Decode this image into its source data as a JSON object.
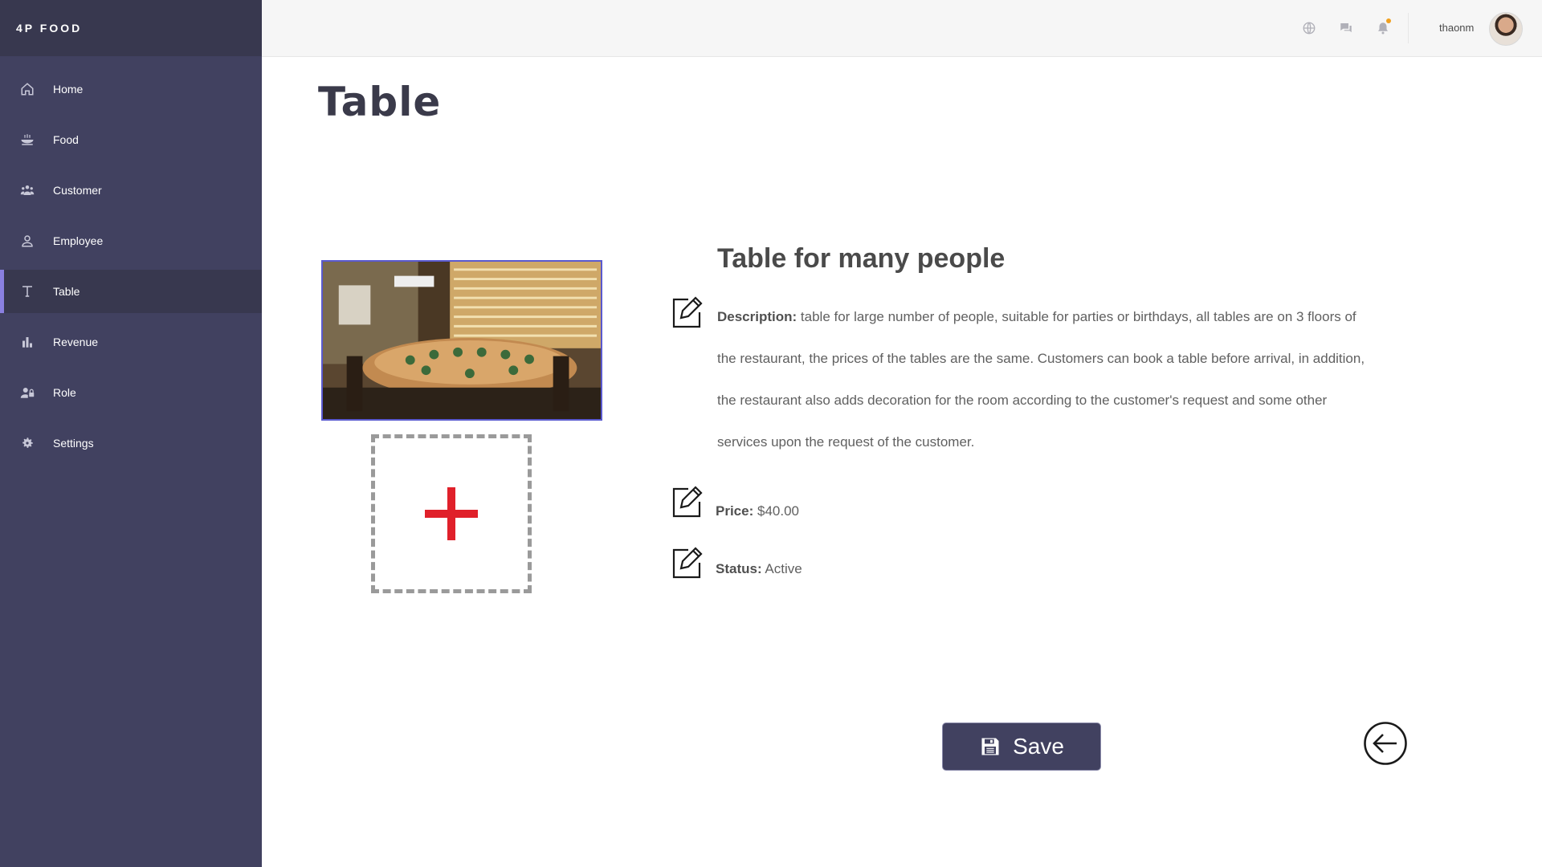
{
  "brand": "4P FOOD",
  "sidebar": {
    "items": [
      {
        "label": "Home",
        "icon": "home-icon"
      },
      {
        "label": "Food",
        "icon": "food-bowl-icon"
      },
      {
        "label": "Customer",
        "icon": "users-icon"
      },
      {
        "label": "Employee",
        "icon": "person-icon"
      },
      {
        "label": "Table",
        "icon": "text-t-icon",
        "active": true
      },
      {
        "label": "Revenue",
        "icon": "bar-chart-icon"
      },
      {
        "label": "Role",
        "icon": "user-lock-icon"
      },
      {
        "label": "Settings",
        "icon": "gear-icon"
      }
    ]
  },
  "topbar": {
    "icons": [
      "globe-icon",
      "chat-icon",
      "bell-icon"
    ],
    "username": "thaonm"
  },
  "page": {
    "title": "Table"
  },
  "item": {
    "name": "Table for many people",
    "description_label": "Description:",
    "description": "table for large number of people, suitable for parties or birthdays, all tables are on 3 floors  of the restaurant, the prices of the tables are the same. Customers can book a table before  arrival, in addition, the  restaurant  also adds  decoration  for the  room according  to the customer's request and some other services upon the request of the customer.",
    "price_label": "Price:",
    "price": "$40.00",
    "status_label": "Status:",
    "status": "Active"
  },
  "actions": {
    "save_label": "Save"
  },
  "colors": {
    "sidebar": "#414160",
    "sidebar_dark": "#38384f",
    "accent": "#8a80e0",
    "plus": "#e0202a",
    "notification": "#f0a020"
  }
}
